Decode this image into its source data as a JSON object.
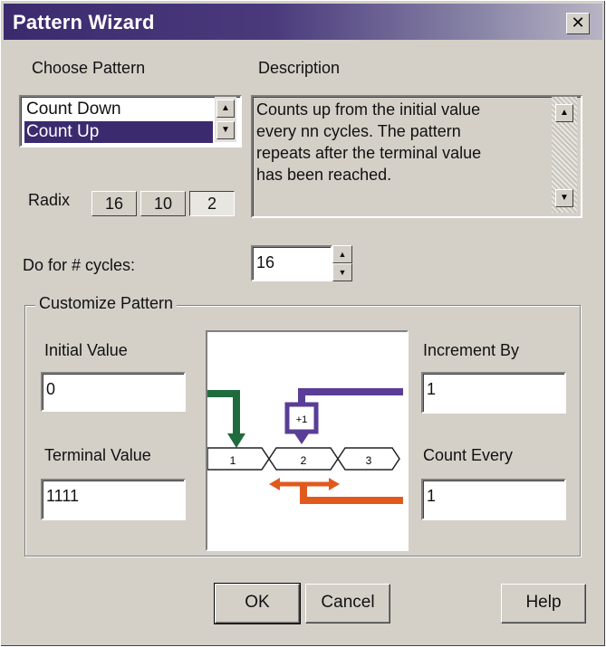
{
  "window": {
    "title": "Pattern Wizard",
    "close_glyph": "✕"
  },
  "choose_pattern": {
    "label": "Choose Pattern",
    "items": [
      "Count Down",
      "Count Up"
    ],
    "selected_index": 1
  },
  "description": {
    "label": "Description",
    "lines": [
      "Counts up from the initial value",
      "every nn cycles.  The pattern",
      "repeats after the terminal value",
      "has been reached."
    ]
  },
  "radix": {
    "label": "Radix",
    "options": [
      "16",
      "10",
      "2"
    ],
    "selected": "2"
  },
  "cycles": {
    "label": "Do for # cycles:",
    "value": "16"
  },
  "customize": {
    "label": "Customize Pattern",
    "initial_value_label": "Initial Value",
    "initial_value": "0",
    "terminal_value_label": "Terminal Value",
    "terminal_value": "1111",
    "increment_by_label": "Increment By",
    "increment_by": "1",
    "count_every_label": "Count Every",
    "count_every": "1"
  },
  "diagram": {
    "states": [
      "1",
      "2",
      "3"
    ],
    "increment_badge": "+1",
    "colors": {
      "initial": "#1f6b3e",
      "increment": "#5a3d96",
      "count_every": "#e05a1e"
    }
  },
  "buttons": {
    "ok": "OK",
    "cancel": "Cancel",
    "help": "Help"
  },
  "scroll_glyphs": {
    "up": "▲",
    "down": "▼"
  }
}
